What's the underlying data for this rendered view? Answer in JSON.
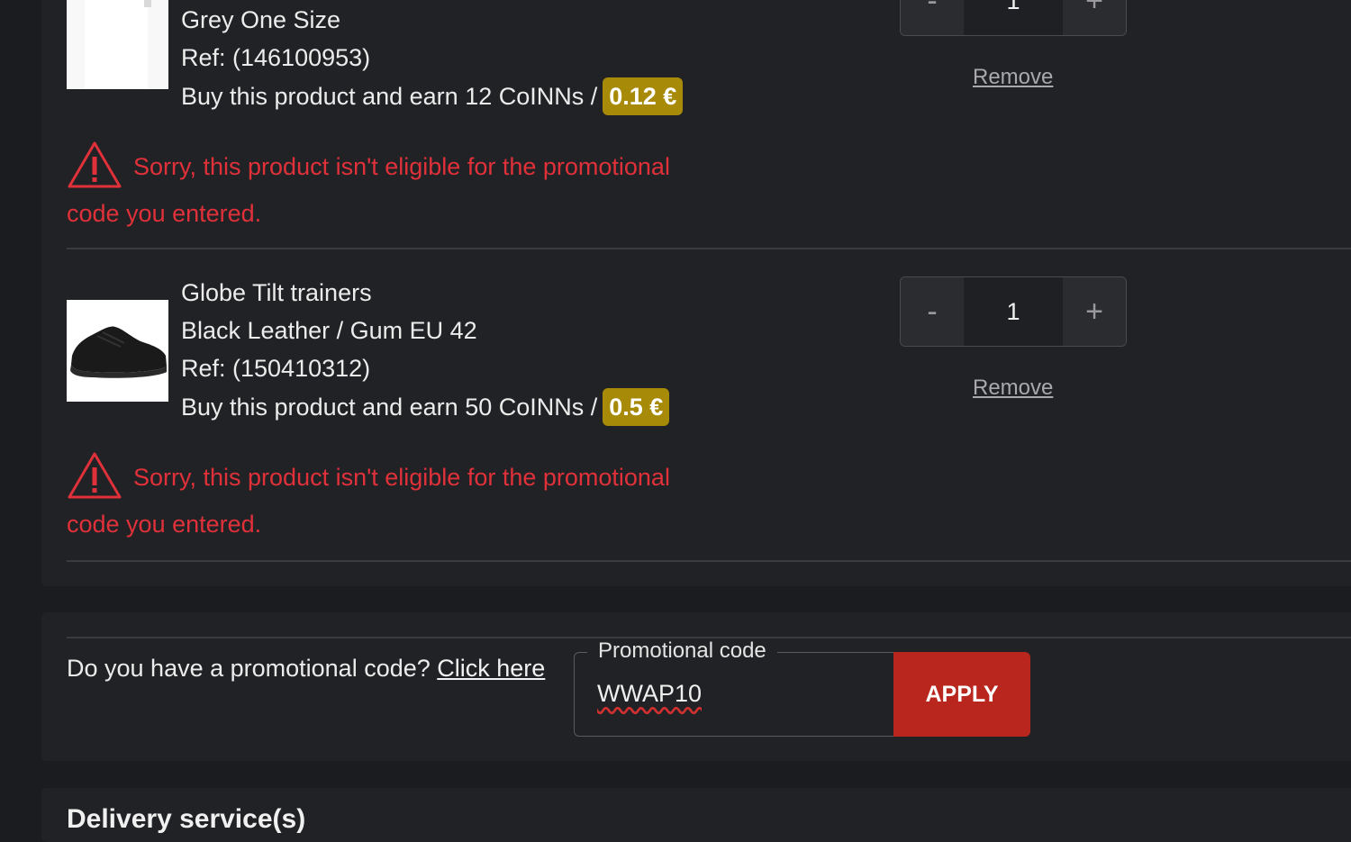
{
  "items": [
    {
      "name": "",
      "variant": "Grey One Size",
      "ref": "Ref: (146100953)",
      "earn_text": "Buy this product and earn 12 CoINNs /",
      "earn_value": "0.12 €",
      "quantity": "1",
      "remove_label": "Remove",
      "warning": "Sorry, this product isn't eligible for the promotional code you entered."
    },
    {
      "name": "Globe Tilt trainers",
      "variant": "Black Leather / Gum EU 42",
      "ref": "Ref: (150410312)",
      "earn_text": "Buy this product and earn 50 CoINNs /",
      "earn_value": "0.5 €",
      "quantity": "1",
      "remove_label": "Remove",
      "warning": "Sorry, this product isn't eligible for the promotional code you entered."
    }
  ],
  "qty_controls": {
    "minus": "-",
    "plus": "+"
  },
  "promo": {
    "question": "Do you have a promotional code?",
    "link_label": "Click here",
    "field_label": "Promotional code",
    "field_value": "WWAP10",
    "apply_label": "APPLY"
  },
  "delivery": {
    "title": "Delivery service(s)"
  },
  "colors": {
    "background": "#1b1c1f",
    "panel": "#212225",
    "warning": "#e0313a",
    "badge": "#a78a07",
    "apply": "#b8261d"
  }
}
